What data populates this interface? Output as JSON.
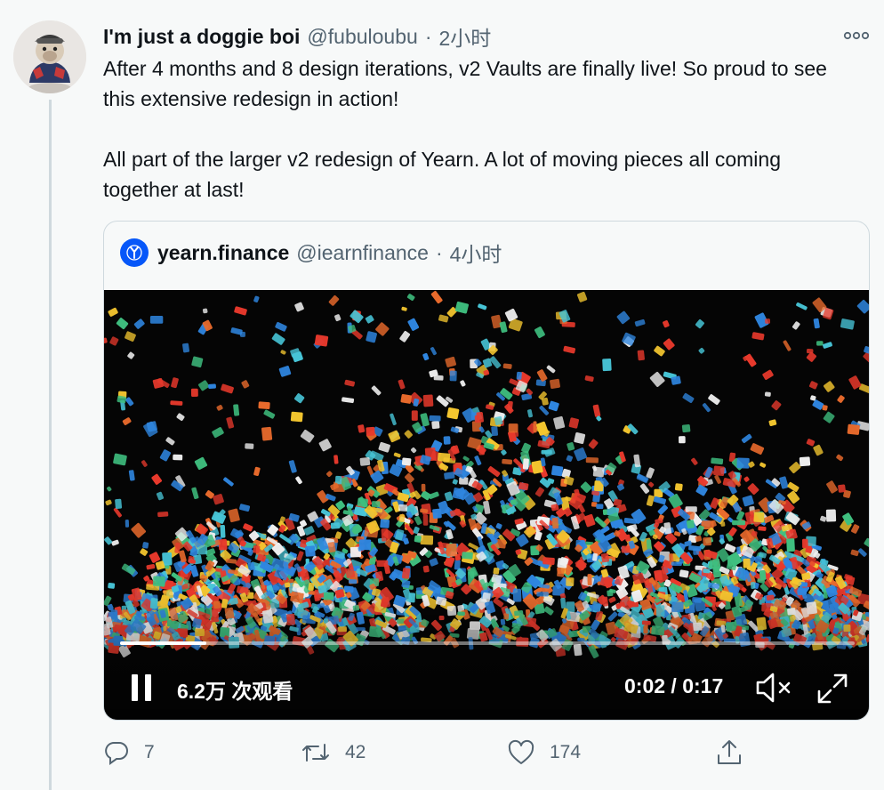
{
  "tweet": {
    "display_name": "I'm just a doggie boi",
    "handle": "@fubuloubu",
    "separator": "·",
    "time": "2小时",
    "more_icon": "more-horizontal-icon",
    "text_paragraphs": [
      "After 4 months and 8 design iterations, v2 Vaults are finally live! So proud to see this extensive redesign in action!",
      "All part of the larger v2 redesign of Yearn. A lot of moving pieces all coming together at last!"
    ]
  },
  "quoted_tweet": {
    "display_name": "yearn.finance",
    "handle": "@iearnfinance",
    "separator": "·",
    "time": "4小时",
    "logo_icon": "yearn-logo-icon",
    "video": {
      "views": "6.2万 次观看",
      "elapsed_total": "0:02 / 0:17",
      "progress": 0.117,
      "state": "playing",
      "controls": [
        "pause-icon",
        "mute-icon",
        "fullscreen-icon"
      ]
    }
  },
  "actions": {
    "reply": {
      "icon": "reply-icon",
      "count": "7"
    },
    "retweet": {
      "icon": "retweet-icon",
      "count": "42"
    },
    "like": {
      "icon": "heart-icon",
      "count": "174"
    },
    "share": {
      "icon": "share-icon"
    }
  },
  "colors": {
    "background": "#f7f9f9",
    "text": "#0f1419",
    "secondary_text": "#536471",
    "border": "#cfd9de",
    "yearn_blue": "#0657f9",
    "video_bg": "#050505"
  }
}
